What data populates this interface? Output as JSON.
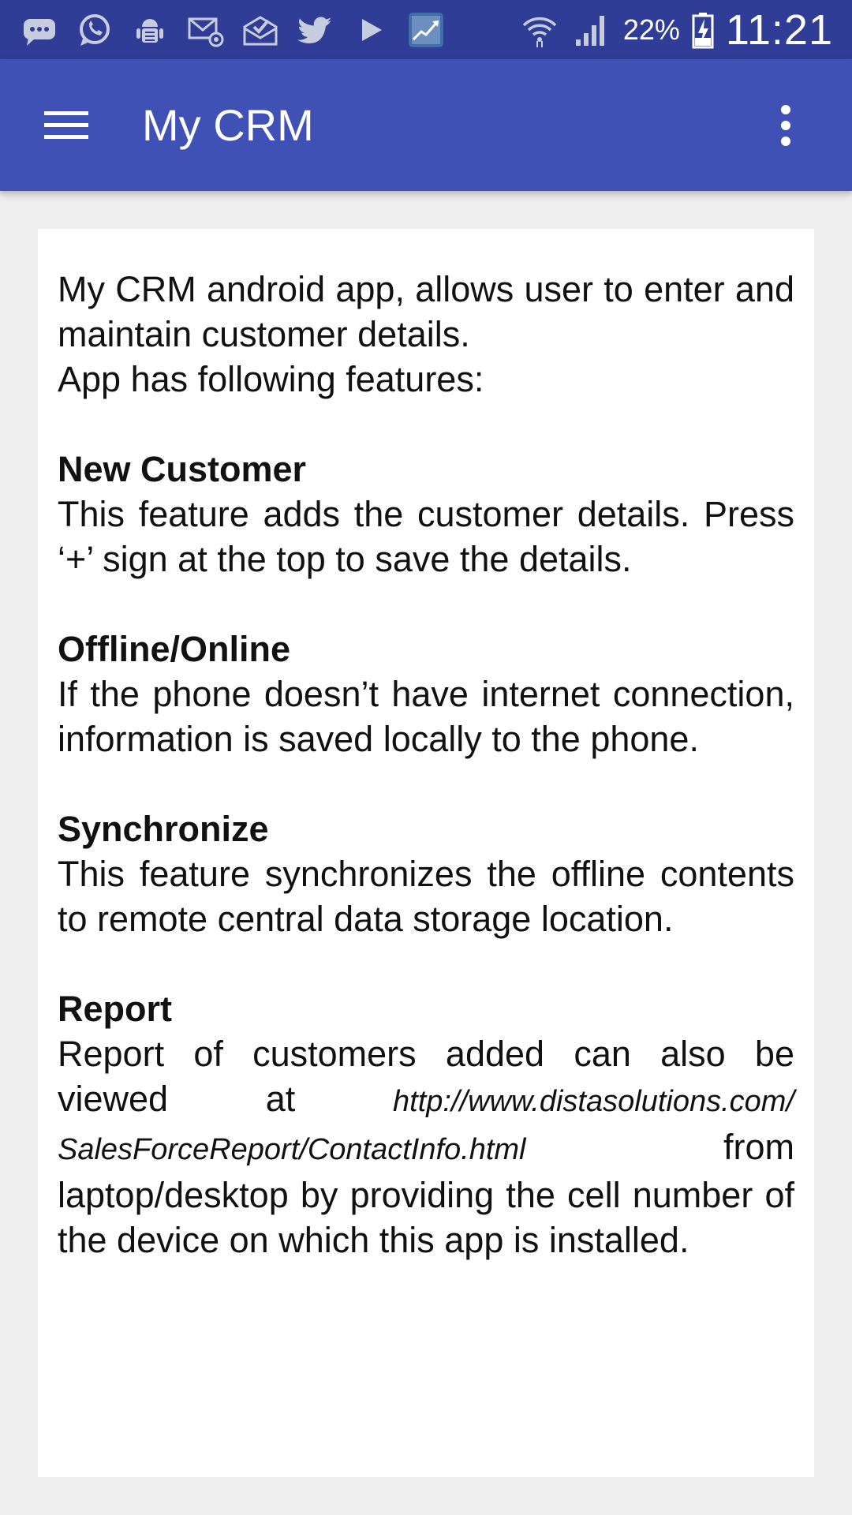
{
  "status_bar": {
    "icons": [
      "message-icon",
      "whatsapp-icon",
      "android-debug-icon",
      "email-icon",
      "mail-check-icon",
      "twitter-icon",
      "play-icon",
      "stocks-app-icon"
    ],
    "battery_percent": "22%",
    "time": "11:21"
  },
  "app_bar": {
    "title": "My CRM"
  },
  "content": {
    "intro_line1": "My CRM android app, allows user to enter and maintain customer details.",
    "intro_line2": "App has following features:",
    "sections": [
      {
        "heading": "New Customer",
        "body": "This feature adds the customer details. Press ‘+’ sign at the top to save the details."
      },
      {
        "heading": "Offline/Online",
        "body": "If the phone doesn’t have internet connection, information is saved locally to the phone."
      },
      {
        "heading": "Synchronize",
        "body": "This feature synchronizes the offline contents to remote central data storage location."
      },
      {
        "heading": "Report",
        "body_before": "Report of customers added can also be viewed at",
        "link": "http://www.distasolutions.com/SalesForceReport/ContactInfo.html",
        "body_after": "from laptop/desktop by providing the cell number of the device on which this app is installed."
      }
    ]
  }
}
